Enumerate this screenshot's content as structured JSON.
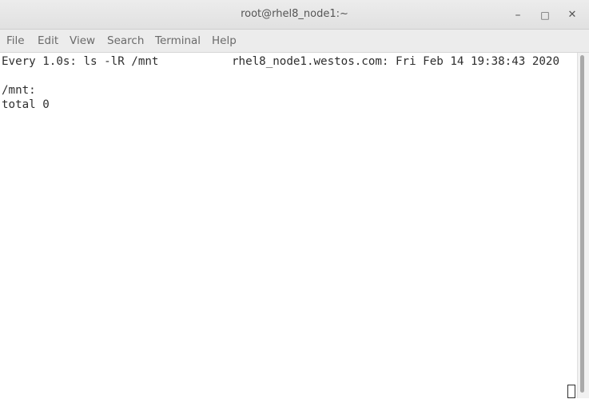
{
  "window": {
    "title": "root@rhel8_node1:~",
    "controls": {
      "minimize": "–",
      "maximize": "□",
      "close": "✕"
    }
  },
  "menubar": {
    "items": [
      "File",
      "Edit",
      "View",
      "Search",
      "Terminal",
      "Help"
    ]
  },
  "terminal": {
    "watch_header_cmd": "Every 1.0s: ls -lR /mnt",
    "watch_header_host": "rhel8_node1.westos.com: Fri Feb 14 19:38:43 2020",
    "output_lines": [
      "",
      "/mnt:",
      "total 0"
    ]
  },
  "colors": {
    "titlebar": "#e6e6e6",
    "menubar": "#ececec",
    "terminal_bg": "#ffffff",
    "terminal_fg": "#2e2e2e"
  }
}
